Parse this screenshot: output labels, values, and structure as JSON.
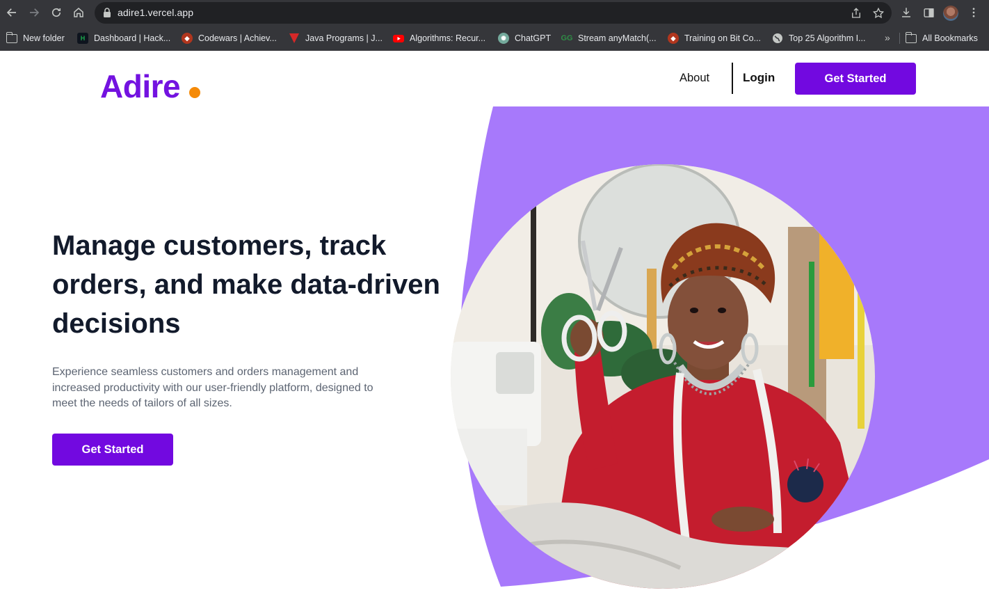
{
  "browser": {
    "url": "adire1.vercel.app",
    "bookmarks": [
      {
        "label": "New folder",
        "icon": "folder-icon"
      },
      {
        "label": "Dashboard | Hack...",
        "icon": "hackerrank-icon",
        "color": "#1ba94c"
      },
      {
        "label": "Codewars | Achiev...",
        "icon": "codewars-icon",
        "color": "#b1361e"
      },
      {
        "label": "Java Programs | J...",
        "icon": "javatpoint-icon",
        "color": "#d62828"
      },
      {
        "label": "Algorithms: Recur...",
        "icon": "youtube-icon",
        "color": "#ff0000"
      },
      {
        "label": "ChatGPT",
        "icon": "chatgpt-icon",
        "color": "#74aa9c"
      },
      {
        "label": "Stream anyMatch(...",
        "icon": "geeksforgeeks-icon",
        "color": "#2f8d46"
      },
      {
        "label": "Training on Bit Co...",
        "icon": "codewars-icon",
        "color": "#b1361e"
      },
      {
        "label": "Top 25 Algorithm I...",
        "icon": "globe-icon"
      }
    ],
    "more_label": "»",
    "all_bookmarks": "All Bookmarks"
  },
  "nav": {
    "logo": "Adire",
    "about": "About",
    "login": "Login",
    "cta": "Get Started"
  },
  "hero": {
    "title": "Manage customers, track orders, and make data-driven decisions",
    "subtitle": "Experience seamless customers and orders management and increased productivity with our user-friendly platform, designed to meet the needs of tailors of all sizes.",
    "cta": "Get Started",
    "image": "tailor-woman-with-scissors-photo"
  },
  "colors": {
    "brand": "#7209e0",
    "accent_dot": "#f58a07",
    "hero_shape": "#a779fb",
    "heading": "#121a2b",
    "body_text": "#5c6472"
  }
}
